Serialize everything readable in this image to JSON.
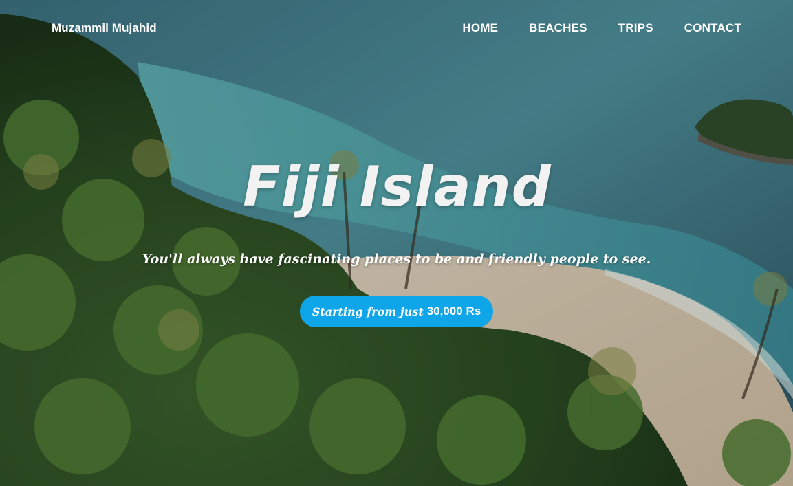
{
  "navbar": {
    "brand": "Muzammil Mujahid",
    "links": [
      "HOME",
      "BEACHES",
      "TRIPS",
      "CONTACT"
    ]
  },
  "hero": {
    "title": "Fiji Island",
    "tagline": "You'll always have fascinating places to be and friendly people to see.",
    "cta_prefix": "Starting from just",
    "cta_price": "30,000 Rs"
  },
  "colors": {
    "cta_background": "#0ea5e9",
    "text": "#ffffff"
  },
  "background": {
    "description_icon": "aerial-beach-photo"
  }
}
